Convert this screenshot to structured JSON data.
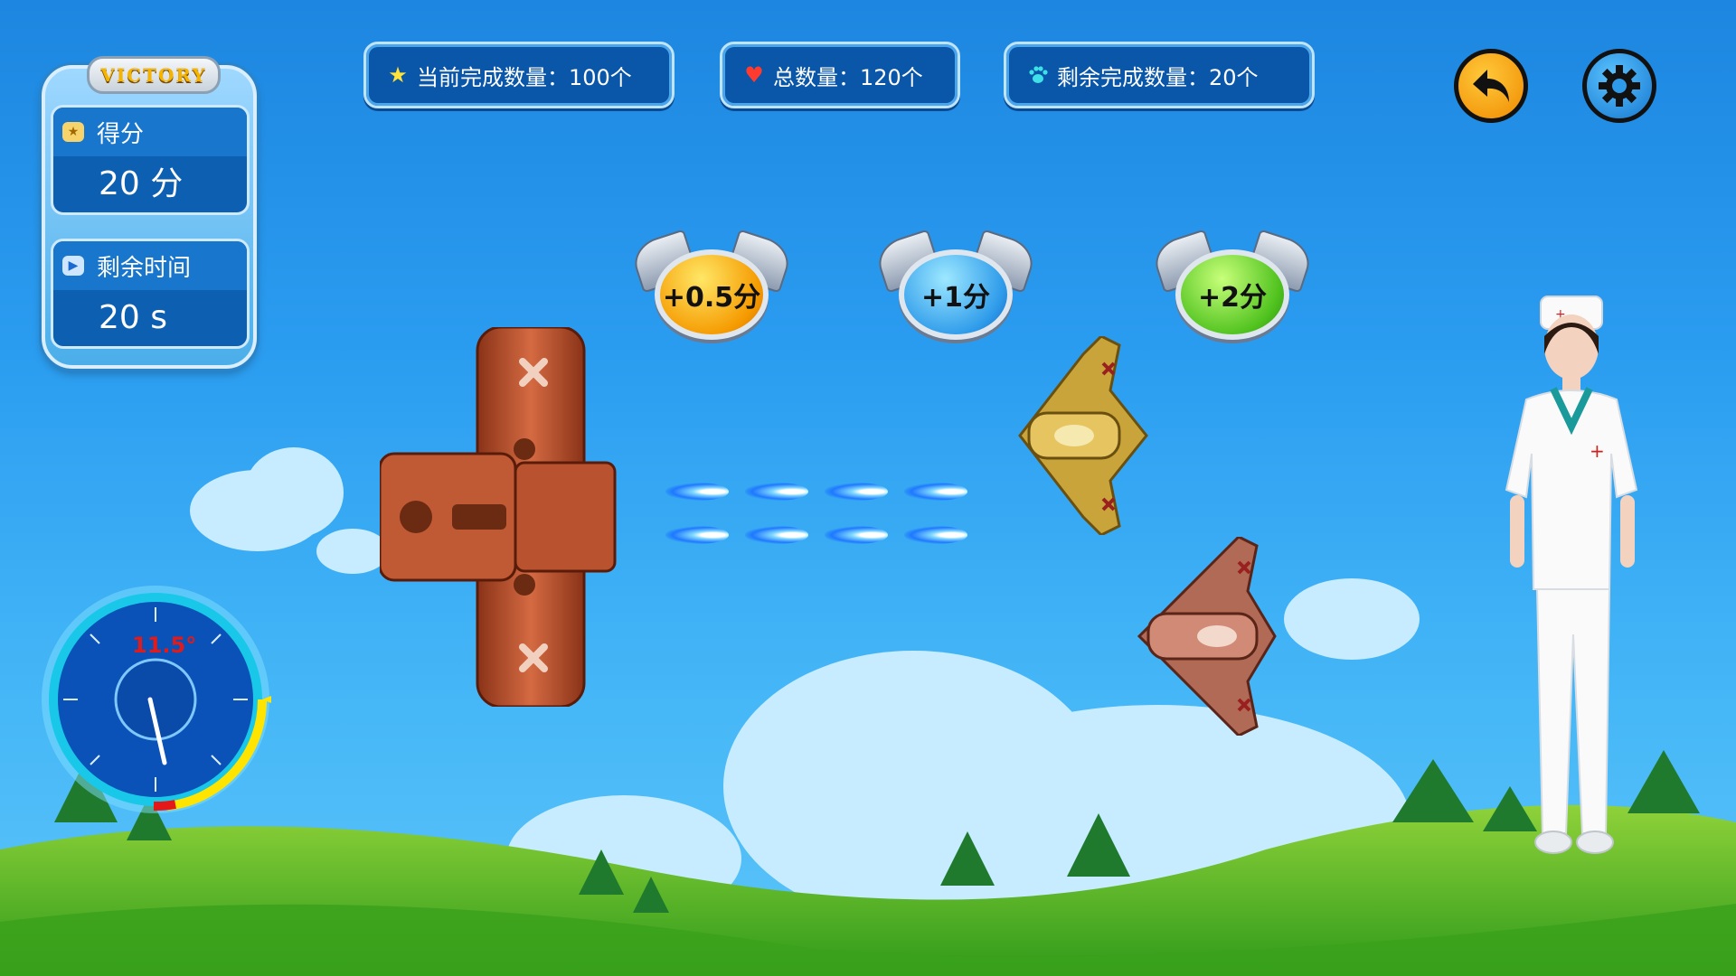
{
  "hud": {
    "victory_label": "VICTORY",
    "score_label": "得分",
    "score_value": "20 分",
    "time_label": "剩余时间",
    "time_value": "20 s"
  },
  "stats": {
    "current": "当前完成数量：100个",
    "total": "总数量：120个",
    "remaining": "剩余完成数量：20个"
  },
  "rewards": [
    {
      "label": "+0.5分",
      "color": "#f5a000"
    },
    {
      "label": "+1分",
      "color": "#2e9bea"
    },
    {
      "label": "+2分",
      "color": "#4fc21e"
    }
  ],
  "gauge": {
    "angle_text": "11.5°"
  },
  "icons": {
    "star": "star-icon",
    "heart": "heart-icon",
    "paw": "paw-icon",
    "back": "back-arrow-icon",
    "settings": "gear-icon"
  }
}
